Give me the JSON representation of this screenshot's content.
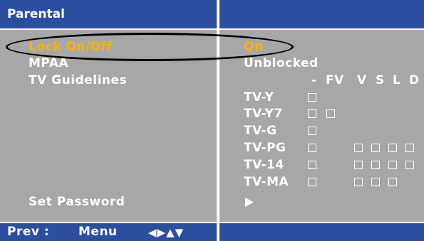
{
  "header": {
    "title": "Parental"
  },
  "menu": {
    "lock": {
      "label": "Lock On/Off",
      "value": "On"
    },
    "mpaa": {
      "label": "MPAA",
      "value": "Unblocked"
    },
    "tv_guidelines": {
      "label": "TV Guidelines"
    },
    "set_password": {
      "label": "Set Password"
    }
  },
  "grid": {
    "columns": [
      "-",
      "FV",
      "V",
      "S",
      "L",
      "D"
    ],
    "rows": [
      {
        "label": "TV-Y"
      },
      {
        "label": "TV-Y7"
      },
      {
        "label": "TV-G"
      },
      {
        "label": "TV-PG"
      },
      {
        "label": "TV-14"
      },
      {
        "label": "TV-MA"
      }
    ]
  },
  "footer": {
    "prev_label": "Prev :",
    "menu_label": "Menu",
    "nav_hint": "◀▶▲▼"
  },
  "colors": {
    "bar": "#2b4f9e",
    "panel": "#a7a7a7",
    "selected": "#f5b400",
    "text": "#ffffff"
  }
}
